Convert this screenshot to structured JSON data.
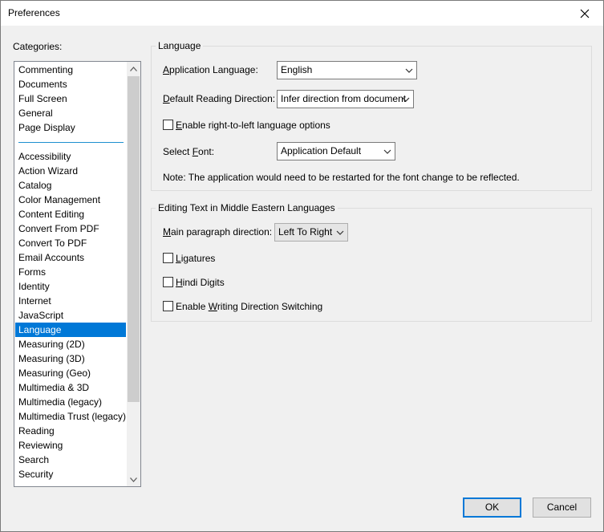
{
  "window": {
    "title": "Preferences"
  },
  "categories": {
    "label": "Categories:",
    "group1": [
      "Commenting",
      "Documents",
      "Full Screen",
      "General",
      "Page Display"
    ],
    "group2": [
      "Accessibility",
      "Action Wizard",
      "Catalog",
      "Color Management",
      "Content Editing",
      "Convert From PDF",
      "Convert To PDF",
      "Email Accounts",
      "Forms",
      "Identity",
      "Internet",
      "JavaScript",
      "Language",
      "Measuring (2D)",
      "Measuring (3D)",
      "Measuring (Geo)",
      "Multimedia & 3D",
      "Multimedia (legacy)",
      "Multimedia Trust (legacy)",
      "Reading",
      "Reviewing",
      "Search",
      "Security"
    ],
    "selected": "Language"
  },
  "language_group": {
    "title": "Language",
    "app_language": {
      "label_pre": "",
      "label_key": "A",
      "label_post": "pplication Language:",
      "value": "English"
    },
    "reading_direction": {
      "label_pre": "",
      "label_key": "D",
      "label_post": "efault Reading Direction:",
      "value": "Infer direction from document"
    },
    "rtl_options": {
      "label_pre": "",
      "label_key": "E",
      "label_post": "nable right-to-left language options",
      "checked": false
    },
    "select_font": {
      "label_pre": "Select ",
      "label_key": "F",
      "label_post": "ont:",
      "value": "Application Default"
    },
    "note": "Note: The application would need to be restarted for the font change to be reflected."
  },
  "middle_eastern_group": {
    "title": "Editing Text in Middle Eastern Languages",
    "paragraph_direction": {
      "label_pre": "",
      "label_key": "M",
      "label_post": "ain paragraph direction:",
      "value": "Left To Right"
    },
    "ligatures": {
      "label_pre": "",
      "label_key": "L",
      "label_post": "igatures",
      "checked": false
    },
    "hindi_digits": {
      "label_pre": "",
      "label_key": "H",
      "label_post": "indi Digits",
      "checked": false
    },
    "writing_direction": {
      "label_pre": "Enable ",
      "label_key": "W",
      "label_post": "riting Direction Switching",
      "checked": false
    }
  },
  "buttons": {
    "ok": "OK",
    "cancel": "Cancel"
  },
  "icons": {
    "close": "close-icon",
    "chevron": "chevron-down-icon",
    "scroll_up": "scroll-up-arrow-icon",
    "scroll_down": "scroll-down-arrow-icon"
  },
  "colors": {
    "selection": "#0078d7",
    "separator": "#1e90d0",
    "default_button_border": "#0078d7"
  }
}
